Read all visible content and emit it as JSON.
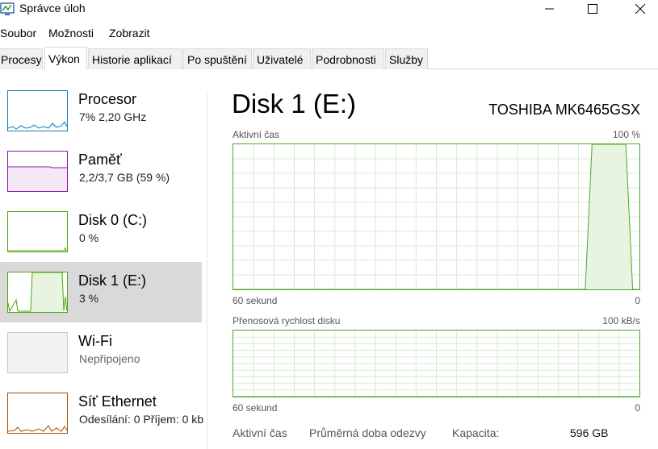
{
  "window": {
    "title": "Správce úloh"
  },
  "menu": [
    "Soubor",
    "Možnosti",
    "Zobrazit"
  ],
  "tabs": [
    "Procesy",
    "Výkon",
    "Historie aplikací",
    "Po spuštění",
    "Uživatelé",
    "Podrobnosti",
    "Služby"
  ],
  "active_tab": "Výkon",
  "sidebar": {
    "items": [
      {
        "name": "Procesor",
        "sub": "7%  2,20 GHz",
        "color": "#117dbb"
      },
      {
        "name": "Paměť",
        "sub": "2,2/3,7 GB (59 %)",
        "color": "#8b12ae"
      },
      {
        "name": "Disk 0 (C:)",
        "sub": "0 %",
        "color": "#4da60c"
      },
      {
        "name": "Disk 1 (E:)",
        "sub": "3 %",
        "color": "#4da60c",
        "selected": true
      },
      {
        "name": "Wi-Fi",
        "sub": "Nepřipojeno",
        "color": "#a0a0a0"
      },
      {
        "name": "Síť Ethernet",
        "sub": "Odesílání: 0  Příjem: 0 kb",
        "color": "#a74f01"
      }
    ]
  },
  "main": {
    "title": "Disk 1 (E:)",
    "device": "TOSHIBA MK6465GSX",
    "graph1": {
      "label": "Aktivní čas",
      "max": "100 %",
      "time": "60 sekund",
      "min": "0"
    },
    "graph2": {
      "label": "Přenosová rychlost disku",
      "max": "100 kB/s",
      "time": "60 sekund",
      "min": "0"
    },
    "stats": {
      "active_time_label": "Aktivní čas",
      "avg_response_label": "Průměrná doba odezvy",
      "capacity_label": "Kapacita:",
      "capacity_value": "596 GB"
    }
  },
  "colors": {
    "disk_green": "#4ea72e",
    "disk_fill": "#e8f4e0",
    "grid": "#d6ecd0",
    "selected_bg": "#d9d9d9"
  },
  "chart_data": [
    {
      "type": "area",
      "title": "Aktivní čas",
      "xlabel": "60 sekund",
      "ylim": [
        0,
        100
      ],
      "x": [
        0,
        1,
        2,
        3,
        4,
        5,
        6,
        7,
        8,
        9,
        10,
        11,
        12,
        13,
        14,
        15,
        16,
        17,
        18,
        19,
        20,
        21,
        22,
        23,
        24,
        25,
        26,
        27,
        28,
        29,
        30,
        31,
        32,
        33,
        34,
        35,
        36,
        37,
        38,
        39,
        40,
        41,
        42,
        43,
        44,
        45,
        46,
        47,
        48,
        49,
        50,
        51,
        52,
        53,
        54,
        55,
        56,
        57,
        58,
        59,
        60
      ],
      "series": [
        {
          "values": [
            0,
            0,
            0,
            0,
            0,
            0,
            0,
            0,
            0,
            0,
            0,
            0,
            0,
            0,
            0,
            0,
            0,
            0,
            0,
            0,
            0,
            0,
            0,
            0,
            0,
            0,
            0,
            0,
            0,
            0,
            0,
            0,
            0,
            0,
            0,
            0,
            0,
            0,
            0,
            0,
            0,
            0,
            0,
            0,
            0,
            0,
            0,
            0,
            0,
            0,
            0,
            0,
            0,
            100,
            100,
            100,
            100,
            100,
            100,
            0,
            0
          ]
        }
      ]
    },
    {
      "type": "line",
      "title": "Přenosová rychlost disku",
      "xlabel": "60 sekund",
      "ylim": [
        0,
        100
      ],
      "series": [
        {
          "values": [
            0,
            0,
            0,
            0,
            0,
            0,
            0,
            0,
            0,
            0,
            0,
            0,
            0,
            0,
            0,
            0,
            0,
            0,
            0,
            0,
            0,
            0,
            0,
            0,
            0,
            0,
            0,
            0,
            0,
            0,
            0,
            0,
            0,
            0,
            0,
            0,
            0,
            0,
            0,
            0,
            0,
            0,
            0,
            0,
            0,
            0,
            0,
            0,
            0,
            0,
            0,
            0,
            0,
            0,
            0,
            0,
            0,
            0,
            0,
            0,
            0
          ]
        }
      ]
    }
  ]
}
